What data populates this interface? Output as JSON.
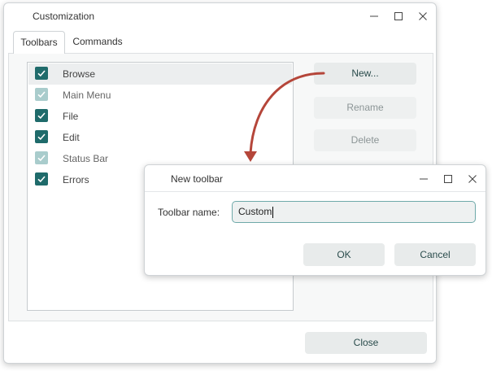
{
  "main_window": {
    "title": "Customization",
    "tabs": [
      {
        "label": "Toolbars",
        "active": true
      },
      {
        "label": "Commands",
        "active": false
      }
    ],
    "toolbar_list": [
      {
        "label": "Browse",
        "checked": true,
        "enabled": true,
        "selected": true
      },
      {
        "label": "Main Menu",
        "checked": true,
        "enabled": false,
        "selected": false
      },
      {
        "label": "File",
        "checked": true,
        "enabled": true,
        "selected": false
      },
      {
        "label": "Edit",
        "checked": true,
        "enabled": true,
        "selected": false
      },
      {
        "label": "Status Bar",
        "checked": true,
        "enabled": false,
        "selected": false
      },
      {
        "label": "Errors",
        "checked": true,
        "enabled": true,
        "selected": false
      }
    ],
    "buttons": {
      "new_label": "New...",
      "rename_label": "Rename",
      "delete_label": "Delete",
      "close_label": "Close"
    }
  },
  "dialog": {
    "title": "New toolbar",
    "field_label": "Toolbar name:",
    "field_value": "Custom",
    "ok_label": "OK",
    "cancel_label": "Cancel"
  },
  "colors": {
    "accent": "#1f6b6b",
    "accent_disabled": "#a9cccc",
    "arrow": "#b5463a",
    "button_bg": "#e8ebeb"
  },
  "icons": [
    "minimize-icon",
    "maximize-icon",
    "close-icon",
    "checkmark-icon"
  ]
}
